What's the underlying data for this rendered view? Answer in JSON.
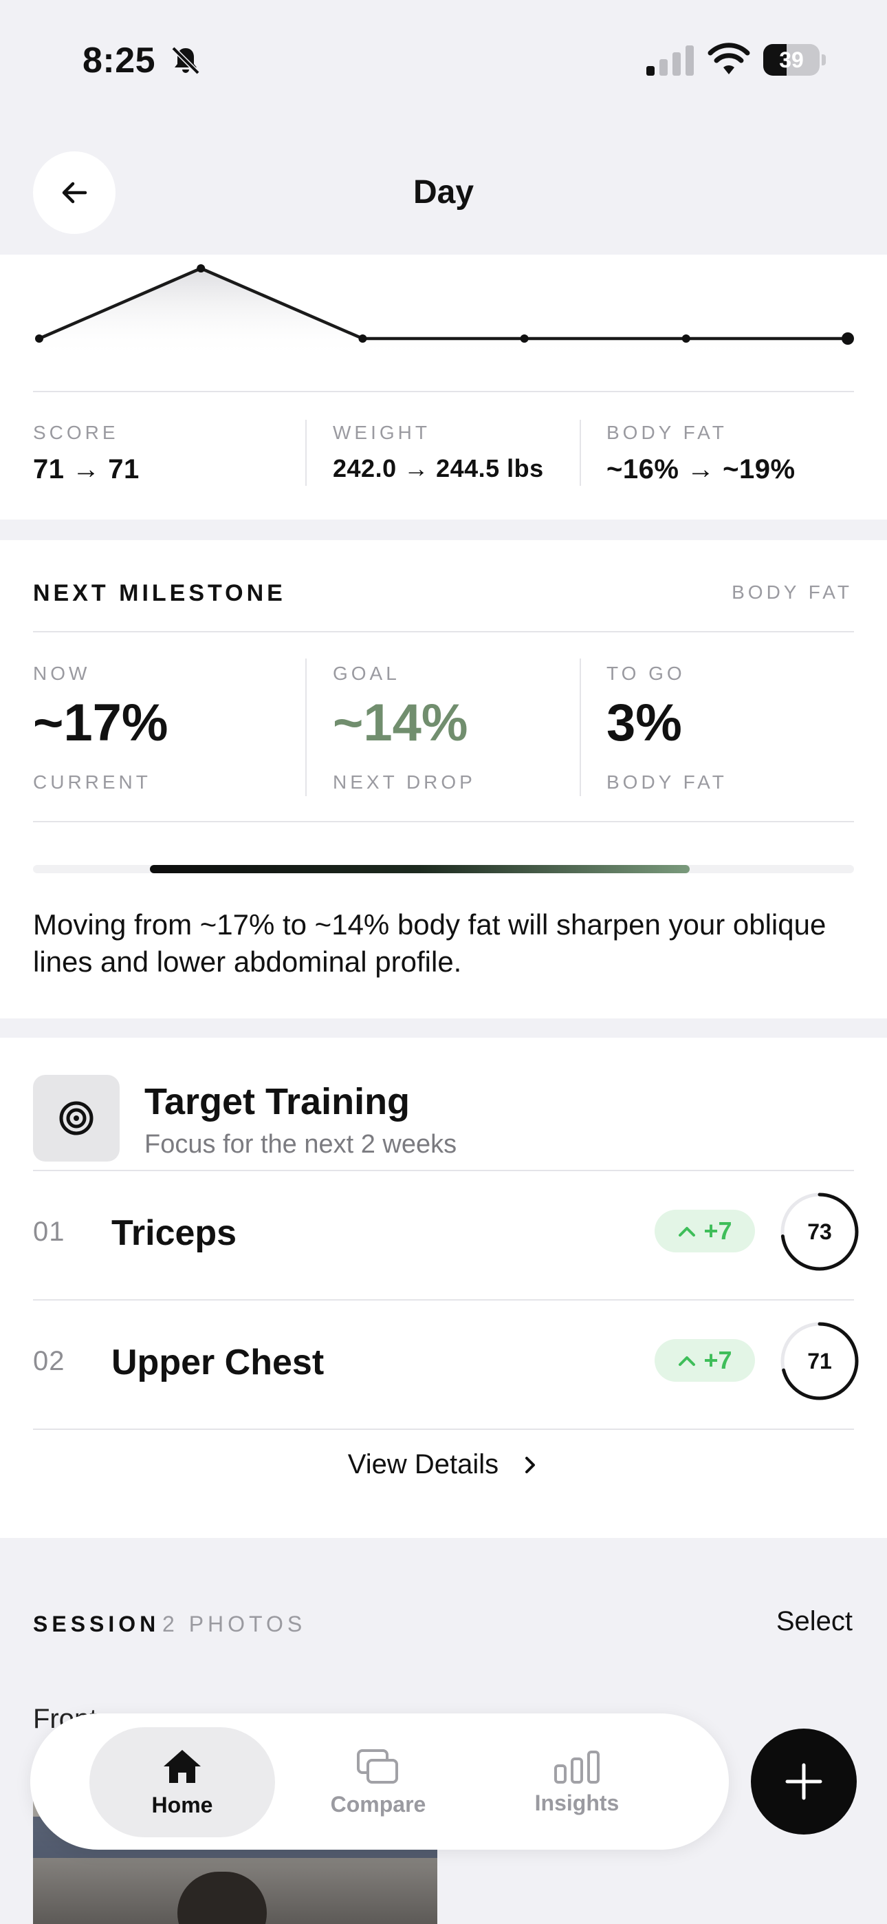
{
  "status_bar": {
    "time": "8:25",
    "battery": "39"
  },
  "header": {
    "title": "Day"
  },
  "trend": {
    "chart_data": {
      "type": "line",
      "x": [
        1,
        2,
        3,
        4,
        5,
        6
      ],
      "values": [
        71,
        76,
        71,
        71,
        71,
        71
      ]
    },
    "stats": [
      {
        "label": "SCORE",
        "value": "71 → 71"
      },
      {
        "label": "WEIGHT",
        "value": "242.0 → 244.5 lbs"
      },
      {
        "label": "BODY FAT",
        "value": "~16% → ~19%"
      }
    ]
  },
  "milestone": {
    "title": "NEXT MILESTONE",
    "category": "BODY FAT",
    "cols": [
      {
        "label": "NOW",
        "value": "~17%",
        "sub": "CURRENT"
      },
      {
        "label": "GOAL",
        "value": "~14%",
        "sub": "NEXT DROP"
      },
      {
        "label": "TO GO",
        "value": "3%",
        "sub": "BODY FAT"
      }
    ],
    "progress": 0.8,
    "description": "Moving from ~17% to ~14% body fat will sharpen your oblique lines and lower abdominal profile."
  },
  "target_training": {
    "icon": "target-icon",
    "title": "Target Training",
    "subtitle": "Focus for the next 2 weeks",
    "items": [
      {
        "num": "01",
        "name": "Triceps",
        "delta": "+7",
        "score": "73",
        "score_value": 73
      },
      {
        "num": "02",
        "name": "Upper Chest",
        "delta": "+7",
        "score": "71",
        "score_value": 71
      }
    ],
    "view_details": "View Details"
  },
  "session": {
    "title": "SESSION",
    "count": "2 PHOTOS",
    "select": "Select",
    "front_label": "Front"
  },
  "tabbar": {
    "tabs": [
      {
        "label": "Home",
        "icon": "home-icon",
        "active": true
      },
      {
        "label": "Compare",
        "icon": "compare-icon",
        "active": false
      },
      {
        "label": "Insights",
        "icon": "insights-icon",
        "active": false
      }
    ]
  },
  "colors": {
    "accent_goal": "#718e6e",
    "delta_green": "#3fbe5a"
  }
}
